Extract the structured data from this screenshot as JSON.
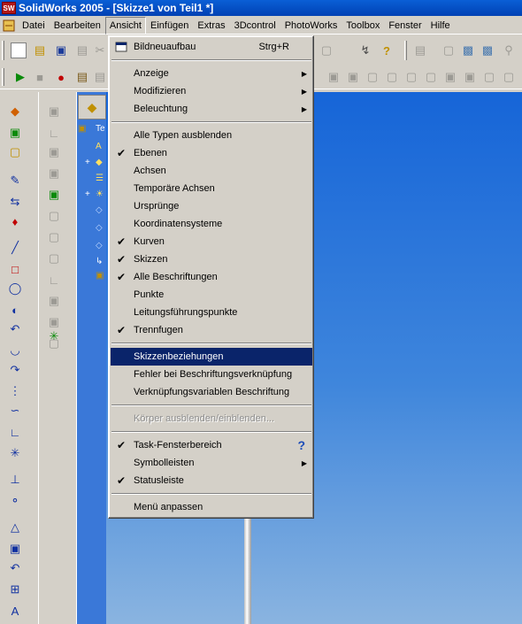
{
  "window": {
    "title": "SolidWorks 2005 - [Skizze1 von Teil1 *]",
    "app_icon": "SW"
  },
  "menubar": {
    "items": [
      "Datei",
      "Bearbeiten",
      "Ansicht",
      "Einfügen",
      "Extras",
      "3Dcontrol",
      "PhotoWorks",
      "Toolbox",
      "Fenster",
      "Hilfe"
    ],
    "active": "Ansicht"
  },
  "dropdown": {
    "items": [
      {
        "label": "Bildneuaufbau",
        "shortcut": "Strg+R",
        "icon": "redraw-icon"
      },
      {
        "label": "Anzeige",
        "submenu": true
      },
      {
        "label": "Modifizieren",
        "submenu": true
      },
      {
        "label": "Beleuchtung",
        "submenu": true
      },
      {
        "label": "Alle Typen ausblenden"
      },
      {
        "label": "Ebenen",
        "checked": true
      },
      {
        "label": "Achsen"
      },
      {
        "label": "Temporäre Achsen"
      },
      {
        "label": "Ursprünge"
      },
      {
        "label": "Koordinatensysteme"
      },
      {
        "label": "Kurven",
        "checked": true
      },
      {
        "label": "Skizzen",
        "checked": true
      },
      {
        "label": "Alle Beschriftungen",
        "checked": true
      },
      {
        "label": "Punkte"
      },
      {
        "label": "Leitungsführungspunkte"
      },
      {
        "label": "Trennfugen",
        "checked": true
      },
      {
        "label": "Skizzenbeziehungen",
        "highlighted": true
      },
      {
        "label": "Fehler bei Beschriftungsverknüpfung"
      },
      {
        "label": "Verknüpfungsvariablen Beschriftung"
      },
      {
        "label": "Körper ausblenden/einblenden...",
        "disabled": true
      },
      {
        "label": "Task-Fensterbereich",
        "checked": true,
        "icon": "help-icon"
      },
      {
        "label": "Symbolleisten",
        "submenu": true
      },
      {
        "label": "Statusleiste",
        "checked": true
      },
      {
        "label": "Menü anpassen"
      }
    ]
  },
  "feature_manager": {
    "tree_first_label": "Te"
  },
  "colors": {
    "highlight": "#0a246a",
    "viewport_top": "#1665d8",
    "viewport_bottom": "#8ab4e0",
    "title_bar": "#0a5fd6"
  }
}
